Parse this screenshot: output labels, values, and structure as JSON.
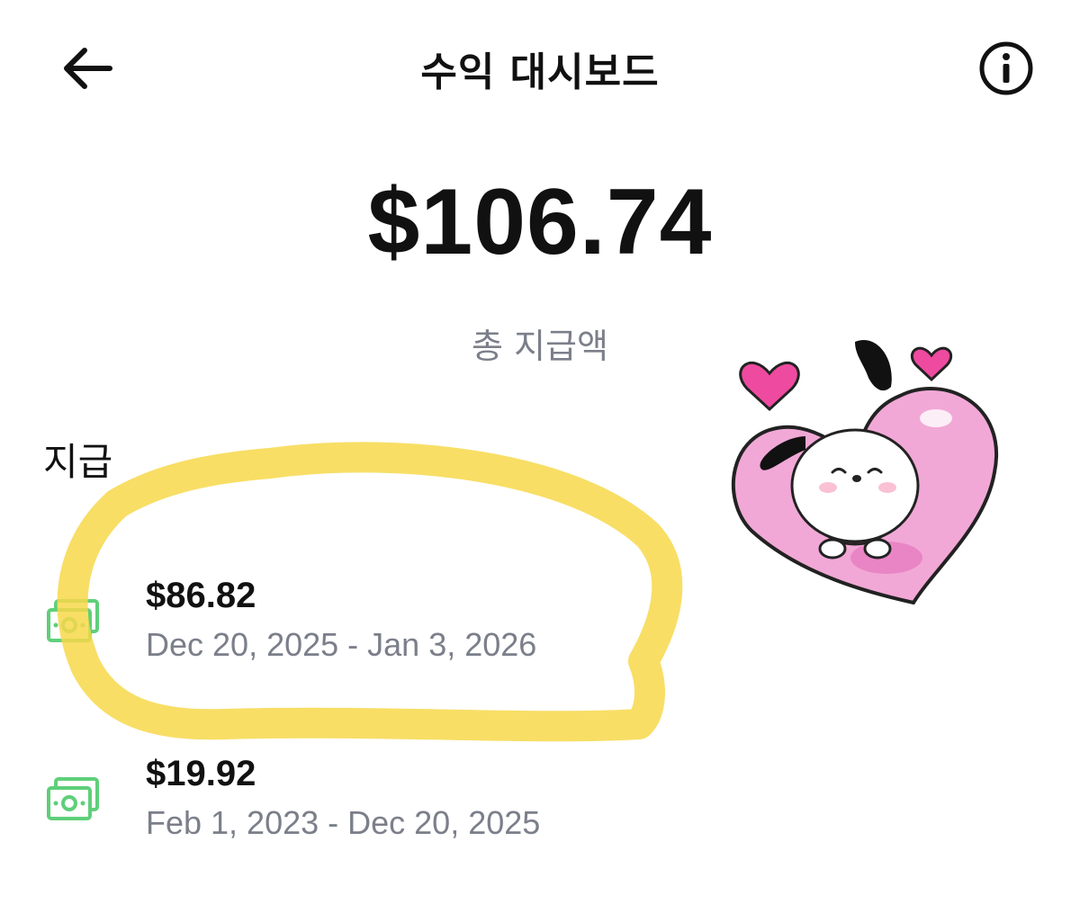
{
  "header": {
    "title": "수익 대시보드",
    "back_icon": "arrow-left-icon",
    "info_icon": "info-icon"
  },
  "summary": {
    "total_amount": "$106.74",
    "total_label": "총 지급액"
  },
  "payouts": {
    "section_title": "지급",
    "items": [
      {
        "amount": "$86.82",
        "range": "Dec 20, 2025 - Jan 3, 2026",
        "icon": "money-bill-icon"
      },
      {
        "amount": "$19.92",
        "range": "Feb 1, 2023 - Dec 20, 2025",
        "icon": "money-bill-icon"
      }
    ]
  },
  "annotations": {
    "highlight_color": "#f7d84a",
    "money_icon_color": "#5fcf7a"
  },
  "sticker": {
    "description_icon": "puppy-heart-sticker"
  }
}
